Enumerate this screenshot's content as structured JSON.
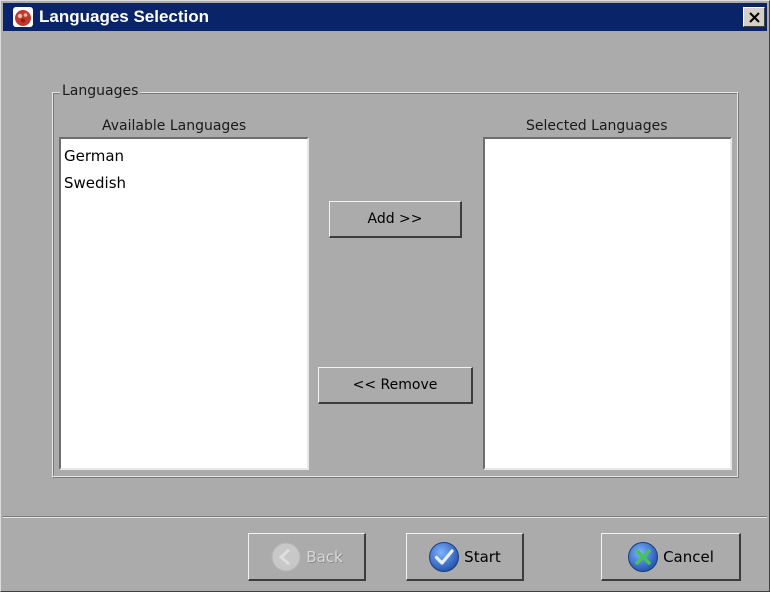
{
  "window": {
    "title": "Languages Selection"
  },
  "group": {
    "legend": "Languages"
  },
  "available": {
    "label": "Available Languages",
    "items": [
      "German",
      "Swedish"
    ]
  },
  "selected": {
    "label": "Selected Languages",
    "items": []
  },
  "buttons": {
    "add": "Add >>",
    "remove": "<< Remove",
    "back": "Back",
    "start": "Start",
    "cancel": "Cancel"
  },
  "icons": {
    "app": "app-icon",
    "close": "close-icon",
    "back": "back-icon",
    "start": "checkmark-icon",
    "cancel": "cancel-x-icon"
  },
  "colors": {
    "titlebar": "#0a246a",
    "window_bg": "#ababab",
    "start_icon": "#2f6fc7",
    "check_mark": "#e9f0ff",
    "cancel_x": "#46c25c"
  },
  "state": {
    "back_enabled": false
  }
}
